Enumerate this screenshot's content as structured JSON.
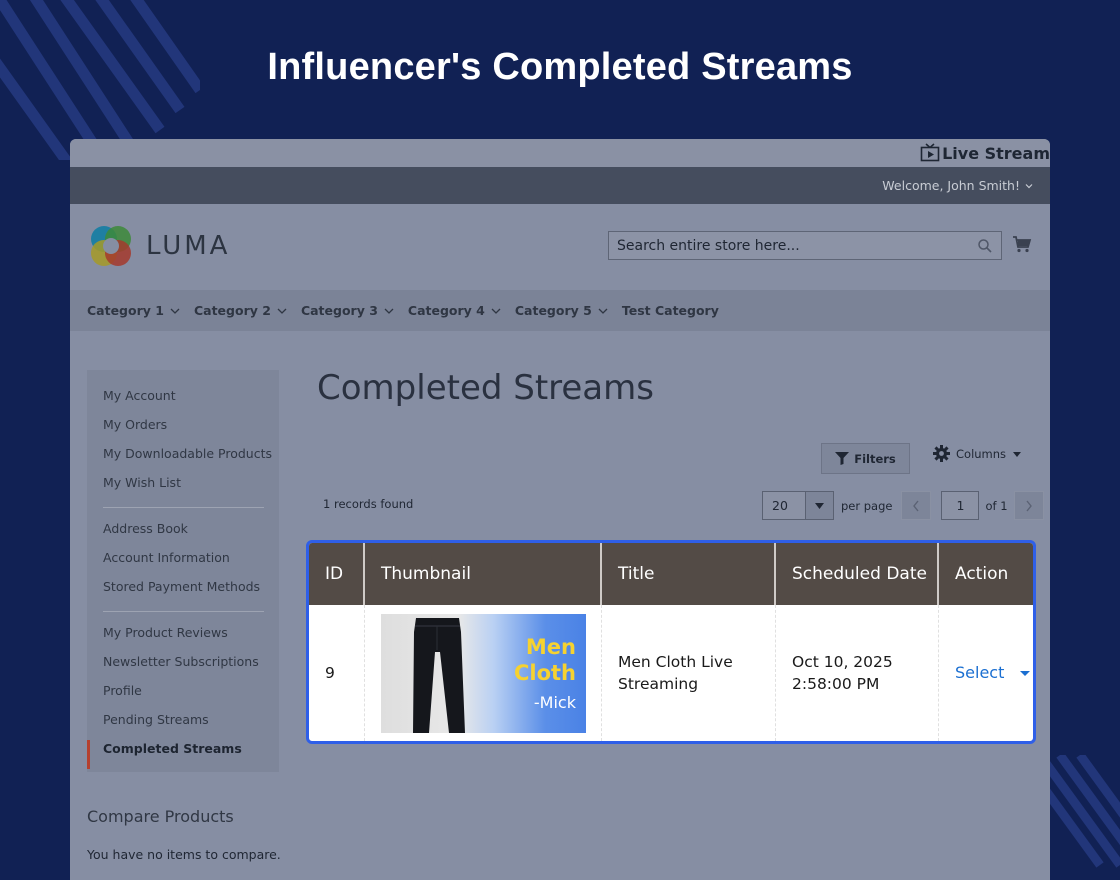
{
  "hero": {
    "title": "Influencer's Completed Streams"
  },
  "topbar": {
    "live_stream": "Live Stream",
    "welcome": "Welcome, John Smith!"
  },
  "header": {
    "logo_text": "LUMA",
    "search_placeholder": "Search entire store here..."
  },
  "nav": {
    "items": [
      "Category 1",
      "Category 2",
      "Category 3",
      "Category 4",
      "Category 5",
      "Test Category"
    ]
  },
  "sidebar": {
    "group1": [
      "My Account",
      "My Orders",
      "My Downloadable Products",
      "My Wish List"
    ],
    "group2": [
      "Address Book",
      "Account Information",
      "Stored Payment Methods"
    ],
    "group3": [
      "My Product Reviews",
      "Newsletter Subscriptions",
      "Profile",
      "Pending Streams",
      "Completed Streams"
    ],
    "active": "Completed Streams"
  },
  "compare": {
    "title": "Compare Products",
    "text": "You have no items to compare."
  },
  "main": {
    "title": "Completed Streams",
    "filters_label": "Filters",
    "columns_label": "Columns",
    "records_found": "1 records found",
    "per_page_value": "20",
    "per_page_label": "per page",
    "page_value": "1",
    "page_of": "of 1"
  },
  "grid": {
    "headers": [
      "ID",
      "Thumbnail",
      "Title",
      "Scheduled Date",
      "Action"
    ],
    "rows": [
      {
        "id": "9",
        "thumb_line1": "Men",
        "thumb_line2": "Cloth",
        "thumb_line3": "-Mick",
        "title": "Men Cloth Live Streaming",
        "date_line1": "Oct 10, 2025",
        "date_line2": "2:58:00 PM",
        "action": "Select"
      }
    ]
  },
  "colors": {
    "background": "#112154",
    "grid_header": "#534b46",
    "grid_highlight": "#2f5fe8",
    "action_link": "#1b6fd1",
    "active_marker": "#b5402e"
  }
}
